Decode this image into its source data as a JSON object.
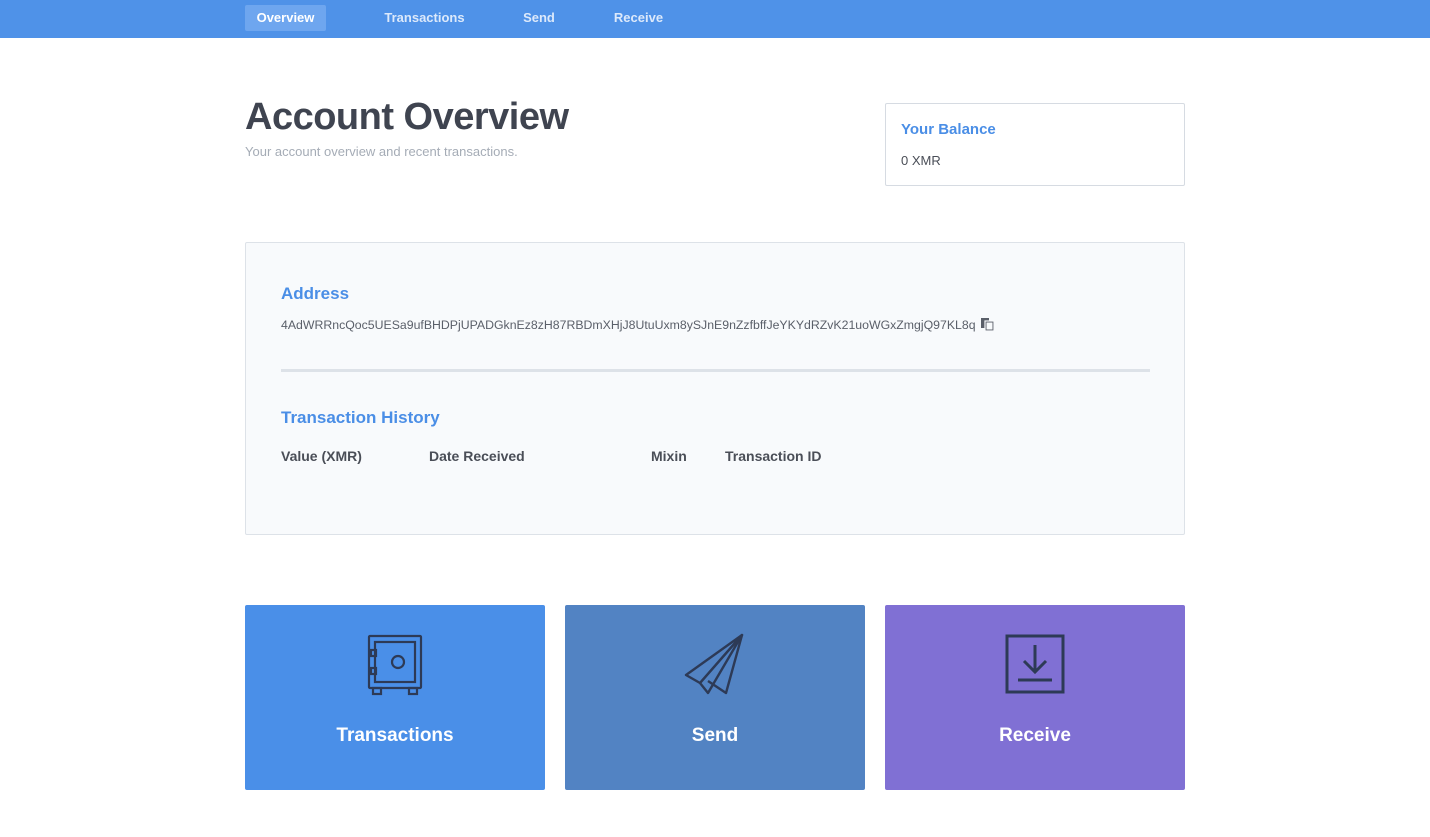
{
  "nav": {
    "items": [
      {
        "label": "Overview",
        "active": true
      },
      {
        "label": "Transactions",
        "active": false
      },
      {
        "label": "Send",
        "active": false
      },
      {
        "label": "Receive",
        "active": false
      }
    ]
  },
  "header": {
    "title": "Account Overview",
    "subtitle": "Your account overview and recent transactions."
  },
  "balance": {
    "title": "Your Balance",
    "value": "0 XMR"
  },
  "address": {
    "title": "Address",
    "value": "4AdWRRncQoc5UESa9ufBHDPjUPADGknEz8zH87RBDmXHjJ8UtuUxm8ySJnE9nZzfbffJeYKYdRZvK21uoWGxZmgjQ97KL8q"
  },
  "history": {
    "title": "Transaction History",
    "columns": [
      "Value (XMR)",
      "Date Received",
      "Mixin",
      "Transaction ID"
    ],
    "rows": []
  },
  "tiles": [
    {
      "label": "Transactions",
      "icon": "safe-icon"
    },
    {
      "label": "Send",
      "icon": "paper-plane-icon"
    },
    {
      "label": "Receive",
      "icon": "download-tray-icon"
    }
  ],
  "colors": {
    "nav_bg": "#4f92e8",
    "accent": "#4a8ee6",
    "tile_transactions": "#4a8fe8",
    "tile_send": "#5283c3",
    "tile_receive": "#8070d4"
  }
}
